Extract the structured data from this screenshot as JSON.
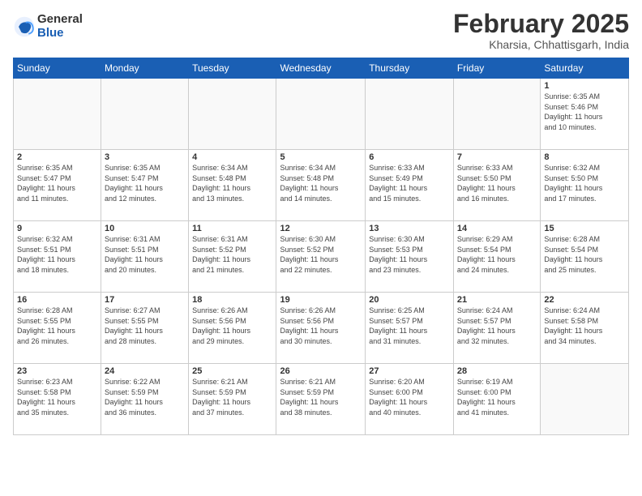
{
  "header": {
    "logo_general": "General",
    "logo_blue": "Blue",
    "month_year": "February 2025",
    "location": "Kharsia, Chhattisgarh, India"
  },
  "days_of_week": [
    "Sunday",
    "Monday",
    "Tuesday",
    "Wednesday",
    "Thursday",
    "Friday",
    "Saturday"
  ],
  "weeks": [
    {
      "days": [
        {
          "num": "",
          "info": ""
        },
        {
          "num": "",
          "info": ""
        },
        {
          "num": "",
          "info": ""
        },
        {
          "num": "",
          "info": ""
        },
        {
          "num": "",
          "info": ""
        },
        {
          "num": "",
          "info": ""
        },
        {
          "num": "1",
          "info": "Sunrise: 6:35 AM\nSunset: 5:46 PM\nDaylight: 11 hours\nand 10 minutes."
        }
      ]
    },
    {
      "days": [
        {
          "num": "2",
          "info": "Sunrise: 6:35 AM\nSunset: 5:47 PM\nDaylight: 11 hours\nand 11 minutes."
        },
        {
          "num": "3",
          "info": "Sunrise: 6:35 AM\nSunset: 5:47 PM\nDaylight: 11 hours\nand 12 minutes."
        },
        {
          "num": "4",
          "info": "Sunrise: 6:34 AM\nSunset: 5:48 PM\nDaylight: 11 hours\nand 13 minutes."
        },
        {
          "num": "5",
          "info": "Sunrise: 6:34 AM\nSunset: 5:48 PM\nDaylight: 11 hours\nand 14 minutes."
        },
        {
          "num": "6",
          "info": "Sunrise: 6:33 AM\nSunset: 5:49 PM\nDaylight: 11 hours\nand 15 minutes."
        },
        {
          "num": "7",
          "info": "Sunrise: 6:33 AM\nSunset: 5:50 PM\nDaylight: 11 hours\nand 16 minutes."
        },
        {
          "num": "8",
          "info": "Sunrise: 6:32 AM\nSunset: 5:50 PM\nDaylight: 11 hours\nand 17 minutes."
        }
      ]
    },
    {
      "days": [
        {
          "num": "9",
          "info": "Sunrise: 6:32 AM\nSunset: 5:51 PM\nDaylight: 11 hours\nand 18 minutes."
        },
        {
          "num": "10",
          "info": "Sunrise: 6:31 AM\nSunset: 5:51 PM\nDaylight: 11 hours\nand 20 minutes."
        },
        {
          "num": "11",
          "info": "Sunrise: 6:31 AM\nSunset: 5:52 PM\nDaylight: 11 hours\nand 21 minutes."
        },
        {
          "num": "12",
          "info": "Sunrise: 6:30 AM\nSunset: 5:52 PM\nDaylight: 11 hours\nand 22 minutes."
        },
        {
          "num": "13",
          "info": "Sunrise: 6:30 AM\nSunset: 5:53 PM\nDaylight: 11 hours\nand 23 minutes."
        },
        {
          "num": "14",
          "info": "Sunrise: 6:29 AM\nSunset: 5:54 PM\nDaylight: 11 hours\nand 24 minutes."
        },
        {
          "num": "15",
          "info": "Sunrise: 6:28 AM\nSunset: 5:54 PM\nDaylight: 11 hours\nand 25 minutes."
        }
      ]
    },
    {
      "days": [
        {
          "num": "16",
          "info": "Sunrise: 6:28 AM\nSunset: 5:55 PM\nDaylight: 11 hours\nand 26 minutes."
        },
        {
          "num": "17",
          "info": "Sunrise: 6:27 AM\nSunset: 5:55 PM\nDaylight: 11 hours\nand 28 minutes."
        },
        {
          "num": "18",
          "info": "Sunrise: 6:26 AM\nSunset: 5:56 PM\nDaylight: 11 hours\nand 29 minutes."
        },
        {
          "num": "19",
          "info": "Sunrise: 6:26 AM\nSunset: 5:56 PM\nDaylight: 11 hours\nand 30 minutes."
        },
        {
          "num": "20",
          "info": "Sunrise: 6:25 AM\nSunset: 5:57 PM\nDaylight: 11 hours\nand 31 minutes."
        },
        {
          "num": "21",
          "info": "Sunrise: 6:24 AM\nSunset: 5:57 PM\nDaylight: 11 hours\nand 32 minutes."
        },
        {
          "num": "22",
          "info": "Sunrise: 6:24 AM\nSunset: 5:58 PM\nDaylight: 11 hours\nand 34 minutes."
        }
      ]
    },
    {
      "days": [
        {
          "num": "23",
          "info": "Sunrise: 6:23 AM\nSunset: 5:58 PM\nDaylight: 11 hours\nand 35 minutes."
        },
        {
          "num": "24",
          "info": "Sunrise: 6:22 AM\nSunset: 5:59 PM\nDaylight: 11 hours\nand 36 minutes."
        },
        {
          "num": "25",
          "info": "Sunrise: 6:21 AM\nSunset: 5:59 PM\nDaylight: 11 hours\nand 37 minutes."
        },
        {
          "num": "26",
          "info": "Sunrise: 6:21 AM\nSunset: 5:59 PM\nDaylight: 11 hours\nand 38 minutes."
        },
        {
          "num": "27",
          "info": "Sunrise: 6:20 AM\nSunset: 6:00 PM\nDaylight: 11 hours\nand 40 minutes."
        },
        {
          "num": "28",
          "info": "Sunrise: 6:19 AM\nSunset: 6:00 PM\nDaylight: 11 hours\nand 41 minutes."
        },
        {
          "num": "",
          "info": ""
        }
      ]
    }
  ]
}
